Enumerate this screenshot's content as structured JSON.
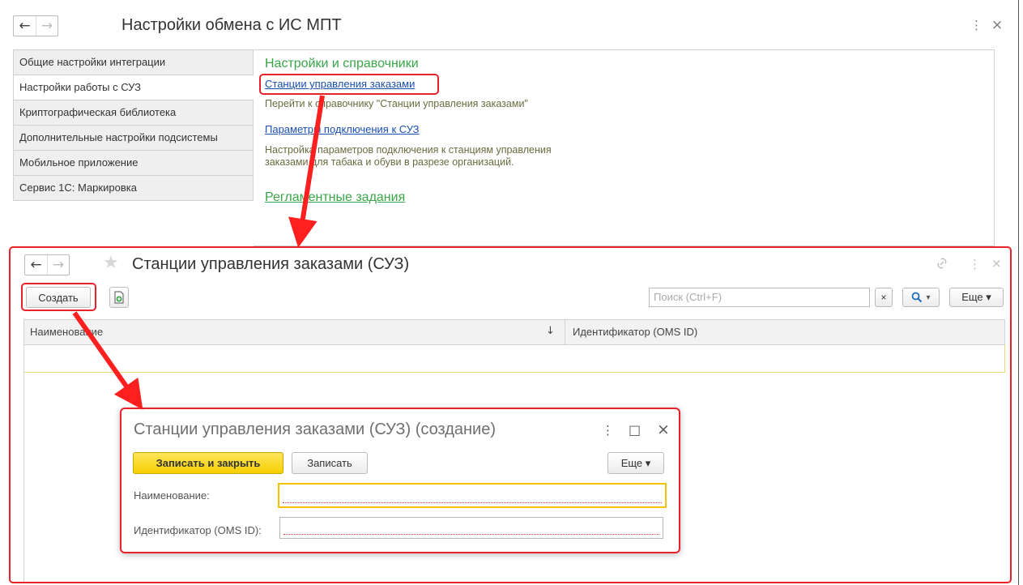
{
  "window": {
    "title": "Настройки обмена с ИС МПТ",
    "nav_back": "←",
    "nav_forward": "→",
    "more_icon": "⋮",
    "close_icon": "×"
  },
  "left_menu": {
    "items": [
      {
        "label": "Общие настройки интеграции",
        "active": false
      },
      {
        "label": "Настройки работы с СУЗ",
        "active": true
      },
      {
        "label": "Криптографическая библиотека",
        "active": false
      },
      {
        "label": "Дополнительные настройки подсистемы",
        "active": false
      },
      {
        "label": "Мобильное приложение",
        "active": false
      },
      {
        "label": "Сервис 1С: Маркировка",
        "active": false
      }
    ]
  },
  "settings_panel": {
    "section_title": "Настройки и справочники",
    "link1": "Станции управления заказами",
    "link1_desc": "Перейти к справочнику \"Станции управления заказами\"",
    "link2": "Параметры подключения к СУЗ",
    "link2_desc_line1": "Настройка параметров подключения к станциям управления",
    "link2_desc_line2": "заказами для табака и обуви в разрезе организаций.",
    "section2_title": "Регламентные задания"
  },
  "list_window": {
    "title": "Станции управления заказами (СУЗ)",
    "nav_back": "←",
    "nav_forward": "→",
    "star_icon": "★",
    "link_icon": "🔗",
    "more_icon": "⋮",
    "close_icon": "×",
    "create_label": "Создать",
    "search_placeholder": "Поиск (Ctrl+F)",
    "search_clear": "×",
    "search_icon": "🔍",
    "dropdown_caret": "▾",
    "more_label": "Еще ▾",
    "columns": [
      {
        "label": "Наименование",
        "sort": "↓"
      },
      {
        "label": "Идентификатор (OMS ID)"
      }
    ]
  },
  "dialog": {
    "title": "Станции управления заказами (СУЗ) (создание)",
    "more_icon": "⋮",
    "maximize_icon": "□",
    "close_icon": "×",
    "save_close_label": "Записать и закрыть",
    "save_label": "Записать",
    "more_label": "Еще ▾",
    "fields": [
      {
        "label": "Наименование:",
        "value": ""
      },
      {
        "label": "Идентификатор (OMS ID):",
        "value": ""
      }
    ]
  },
  "colors": {
    "highlight": "#e8222a",
    "accent_green": "#3aa548",
    "link_blue": "#1a4fb0",
    "primary_yellow": "#f6cf00"
  }
}
